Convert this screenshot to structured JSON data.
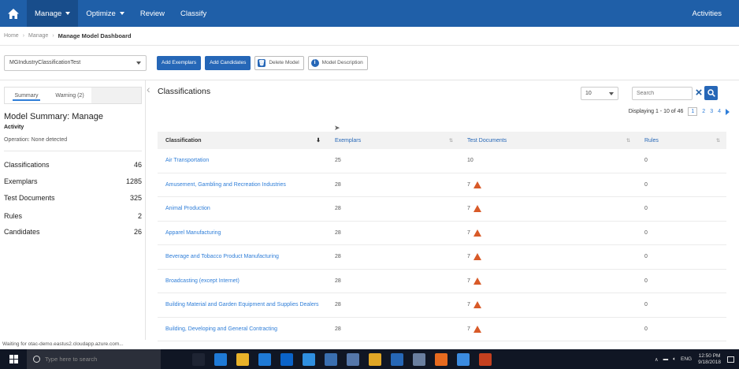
{
  "nav": {
    "items": [
      {
        "label": "Manage",
        "dropdown": true,
        "active": true
      },
      {
        "label": "Optimize",
        "dropdown": true,
        "active": false
      },
      {
        "label": "Review",
        "dropdown": false,
        "active": false
      },
      {
        "label": "Classify",
        "dropdown": false,
        "active": false
      }
    ],
    "right_label": "Activities"
  },
  "breadcrumb": {
    "items": [
      "Home",
      "Manage"
    ],
    "current": "Manage Model Dashboard"
  },
  "toolbar": {
    "model_select": "MGIndustryClassificationTest",
    "add_exemplars": "Add Exemplars",
    "add_candidates": "Add Candidates",
    "delete_model": "Delete Model",
    "model_description": "Model Description"
  },
  "left": {
    "tabs": [
      "Summary",
      "Warning (2)"
    ],
    "summary_title": "Model Summary: Manage",
    "activity_label": "Activity",
    "activity_text": "Operation: None detected",
    "stats": [
      {
        "label": "Classifications",
        "value": "46"
      },
      {
        "label": "Exemplars",
        "value": "1285"
      },
      {
        "label": "Test Documents",
        "value": "325"
      },
      {
        "label": "Rules",
        "value": "2"
      },
      {
        "label": "Candidates",
        "value": "26"
      }
    ]
  },
  "main": {
    "title": "Classifications",
    "page_size": "10",
    "search_placeholder": "Search",
    "pager": {
      "text": "Displaying 1 - 10 of 46",
      "pages": [
        "1",
        "2",
        "3",
        "4"
      ],
      "current": "1"
    },
    "columns": [
      "Classification",
      "Exemplars",
      "Test Documents",
      "Rules"
    ],
    "rows": [
      {
        "name": "Air Transportation",
        "exemplars": "25",
        "tests": "10",
        "warn": false,
        "rules": "0"
      },
      {
        "name": "Amusement, Gambling and Recreation Industries",
        "exemplars": "28",
        "tests": "7",
        "warn": true,
        "rules": "0"
      },
      {
        "name": "Animal Production",
        "exemplars": "28",
        "tests": "7",
        "warn": true,
        "rules": "0"
      },
      {
        "name": "Apparel Manufacturing",
        "exemplars": "28",
        "tests": "7",
        "warn": true,
        "rules": "0"
      },
      {
        "name": "Beverage and Tobacco Product Manufacturing",
        "exemplars": "28",
        "tests": "7",
        "warn": true,
        "rules": "0"
      },
      {
        "name": "Broadcasting (except Internet)",
        "exemplars": "28",
        "tests": "7",
        "warn": true,
        "rules": "0"
      },
      {
        "name": "Building Material and Garden Equipment and Supplies Dealers",
        "exemplars": "28",
        "tests": "7",
        "warn": true,
        "rules": "0"
      },
      {
        "name": "Building, Developing and General Contracting",
        "exemplars": "28",
        "tests": "7",
        "warn": true,
        "rules": "0"
      }
    ]
  },
  "status_text": "Waiting for otac-demo.eastus2.cloudapp.azure.com...",
  "taskbar": {
    "search_placeholder": "Type here to search",
    "language": "ENG",
    "time": "12:50 PM",
    "date": "9/18/2018",
    "icons": [
      {
        "name": "task-view-icon",
        "color": "#1e2433"
      },
      {
        "name": "edge-icon",
        "color": "#1f7ad6"
      },
      {
        "name": "file-explorer-icon",
        "color": "#e8b22a"
      },
      {
        "name": "store-icon",
        "color": "#1f7ad6"
      },
      {
        "name": "outlook-icon",
        "color": "#0a63c9"
      },
      {
        "name": "ie-icon",
        "color": "#2f8fe0"
      },
      {
        "name": "app-icon",
        "color": "#3a6fb0"
      },
      {
        "name": "app-icon",
        "color": "#5577aa"
      },
      {
        "name": "chrome-icon",
        "color": "#e0a626"
      },
      {
        "name": "search-app-icon",
        "color": "#2667b7"
      },
      {
        "name": "app-icon",
        "color": "#6a7fa0"
      },
      {
        "name": "firefox-icon",
        "color": "#e66a1f"
      },
      {
        "name": "app-icon",
        "color": "#3b8be0"
      },
      {
        "name": "powerpoint-icon",
        "color": "#c4401f"
      }
    ]
  }
}
